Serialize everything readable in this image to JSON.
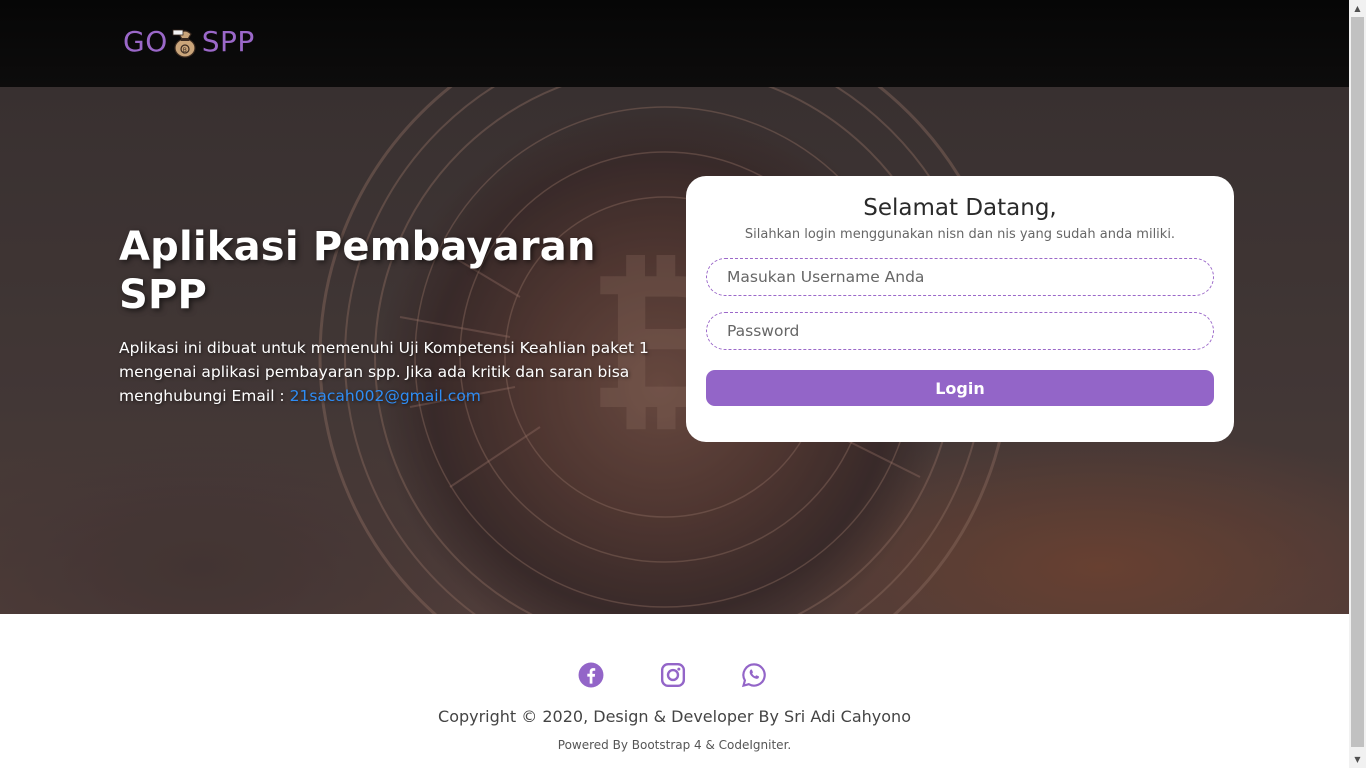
{
  "navbar": {
    "brand_left": "GO",
    "brand_right": "SPP",
    "logo_icon": "money-bag-icon",
    "brand_color": "#9b68c9"
  },
  "hero": {
    "background_icon": "bitcoin-coin",
    "title": "Aplikasi Pembayaran SPP",
    "description": "Aplikasi ini dibuat untuk memenuhi Uji Kompetensi Keahlian paket 1 mengenai aplikasi pembayaran spp. Jika ada kritik dan saran bisa menghubungi Email : ",
    "email": "21sacah002@gmail.com",
    "link_color": "#2e8df5"
  },
  "login": {
    "title": "Selamat Datang,",
    "subtitle": "Silahkan login menggunakan nisn dan nis yang sudah anda miliki.",
    "username_placeholder": "Masukan Username Anda",
    "username_value": "",
    "password_placeholder": "Password",
    "password_value": "",
    "button_label": "Login",
    "accent_color": "#9365c8"
  },
  "footer": {
    "social": [
      {
        "name": "facebook",
        "icon": "facebook-icon"
      },
      {
        "name": "instagram",
        "icon": "instagram-icon"
      },
      {
        "name": "whatsapp",
        "icon": "whatsapp-icon"
      }
    ],
    "copyright": "Copyright © 2020, Design & Developer By Sri Adi Cahyono",
    "powered": "Powered By Bootstrap 4 & CodeIgniter."
  }
}
